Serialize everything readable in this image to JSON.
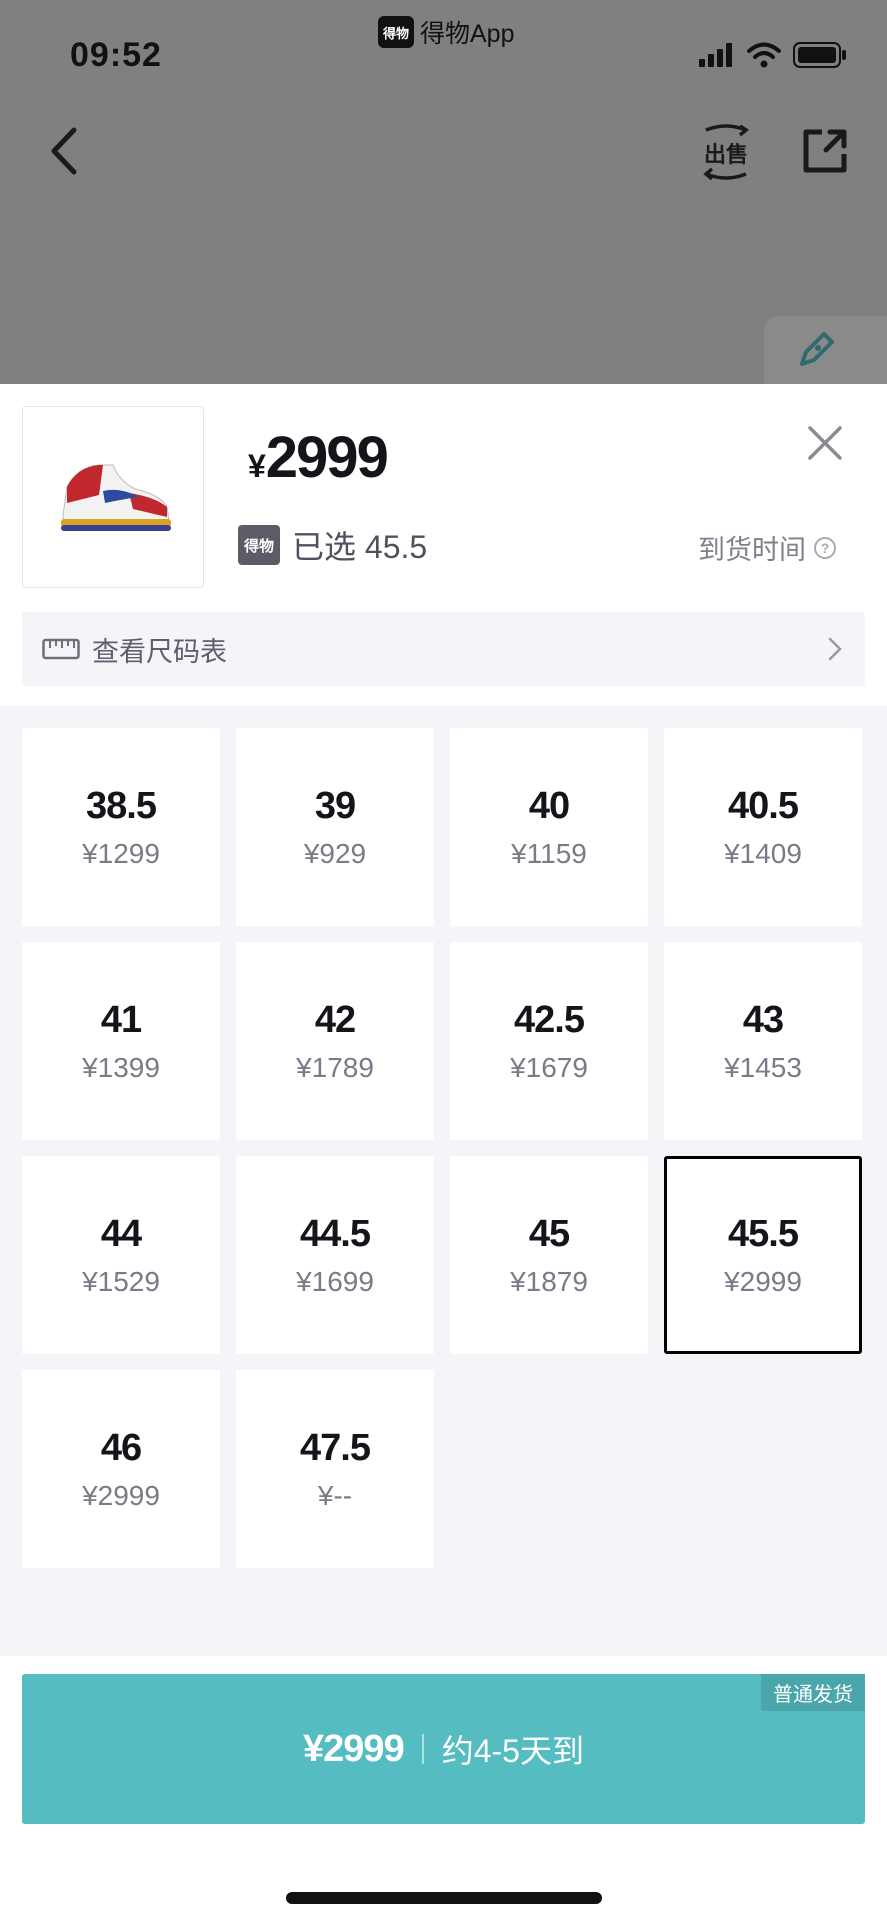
{
  "status_bar": {
    "time": "09:52",
    "app_badge": "得物",
    "app_name": "得物App"
  },
  "nav": {
    "back_icon": "chevron-left-icon",
    "sell_label": "出售",
    "share_icon": "external-share-icon",
    "pen_icon": "pen-icon"
  },
  "product": {
    "currency": "¥",
    "price": "2999",
    "brand_badge": "得物",
    "selected_text": "已选 45.5",
    "arrival_label": "到货时间",
    "help_glyph": "?"
  },
  "size_chart": {
    "label": "查看尺码表"
  },
  "sizes": [
    {
      "size": "38.5",
      "price": "¥1299"
    },
    {
      "size": "39",
      "price": "¥929"
    },
    {
      "size": "40",
      "price": "¥1159"
    },
    {
      "size": "40.5",
      "price": "¥1409"
    },
    {
      "size": "41",
      "price": "¥1399"
    },
    {
      "size": "42",
      "price": "¥1789"
    },
    {
      "size": "42.5",
      "price": "¥1679"
    },
    {
      "size": "43",
      "price": "¥1453"
    },
    {
      "size": "44",
      "price": "¥1529"
    },
    {
      "size": "44.5",
      "price": "¥1699"
    },
    {
      "size": "45",
      "price": "¥1879"
    },
    {
      "size": "45.5",
      "price": "¥2999"
    },
    {
      "size": "46",
      "price": "¥2999"
    },
    {
      "size": "47.5",
      "price": "¥--"
    }
  ],
  "selected_size": "45.5",
  "buy": {
    "price": "¥2999",
    "eta": "约4-5天到",
    "tag": "普通发货"
  },
  "colors": {
    "accent": "#55bcc1",
    "overlay": "#808080",
    "grid_bg": "#f5f5f9"
  }
}
